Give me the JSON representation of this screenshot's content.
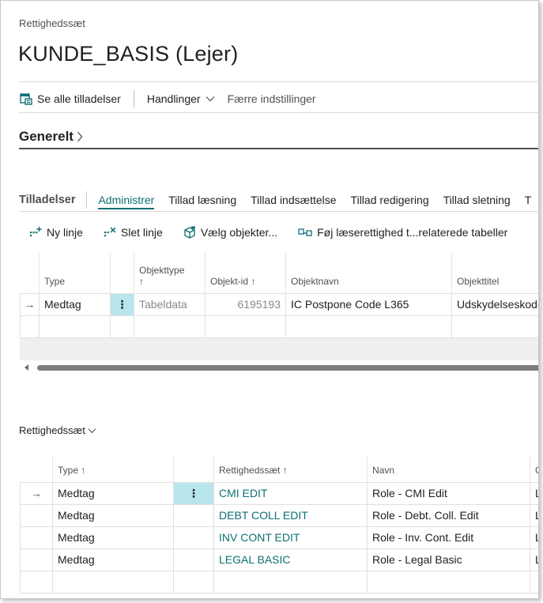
{
  "header": {
    "breadcrumb": "Rettighedssæt",
    "title": "KUNDE_BASIS (Lejer)"
  },
  "actions": {
    "see_all": "Se alle tilladelser",
    "actions_menu": "Handlinger",
    "fewer_settings": "Færre indstillinger"
  },
  "general": {
    "title": "Generelt",
    "chevron": "›"
  },
  "permissions": {
    "title": "Tilladelser",
    "tabs": [
      "Administrer",
      "Tillad læsning",
      "Tillad indsættelse",
      "Tillad redigering",
      "Tillad sletning",
      "T"
    ],
    "toolbar": {
      "new_line": "Ny linje",
      "delete_line": "Slet linje",
      "select_objects": "Vælg objekter...",
      "add_read": "Føj læserettighed t...relaterede tabeller"
    },
    "columns": {
      "type": "Type",
      "object_type": "Objekttype",
      "object_type_sort": "↑",
      "object_id": "Objekt-id ↑",
      "object_name": "Objektnavn",
      "object_caption": "Objekttitel"
    },
    "rows": [
      {
        "arrow": "→",
        "type": "Medtag",
        "dots": "⋮",
        "object_type": "Tabeldata",
        "object_id": "6195193",
        "object_name": "IC Postpone Code L365",
        "object_caption": "Udskydelseskode"
      }
    ]
  },
  "permission_sets": {
    "title": "Rettighedssæt",
    "chevron": "﹀",
    "columns": {
      "type": "Type ↑",
      "set": "Rettighedssæt ↑",
      "name": "Navn",
      "extra": "C"
    },
    "rows": [
      {
        "arrow": "→",
        "type": "Medtag",
        "dots": "⋮",
        "set": "CMI EDIT",
        "name": "Role - CMI Edit",
        "extra": "L"
      },
      {
        "arrow": "",
        "type": "Medtag",
        "dots": "",
        "set": "DEBT COLL EDIT",
        "name": "Role - Debt. Coll. Edit",
        "extra": "L"
      },
      {
        "arrow": "",
        "type": "Medtag",
        "dots": "",
        "set": "INV CONT EDIT",
        "name": "Role - Inv. Cont. Edit",
        "extra": "L"
      },
      {
        "arrow": "",
        "type": "Medtag",
        "dots": "",
        "set": "LEGAL BASIC",
        "name": "Role - Legal Basic",
        "extra": "L"
      }
    ]
  },
  "colors": {
    "accent": "#0f6f73",
    "selected_cell": "#b8e6ec"
  }
}
